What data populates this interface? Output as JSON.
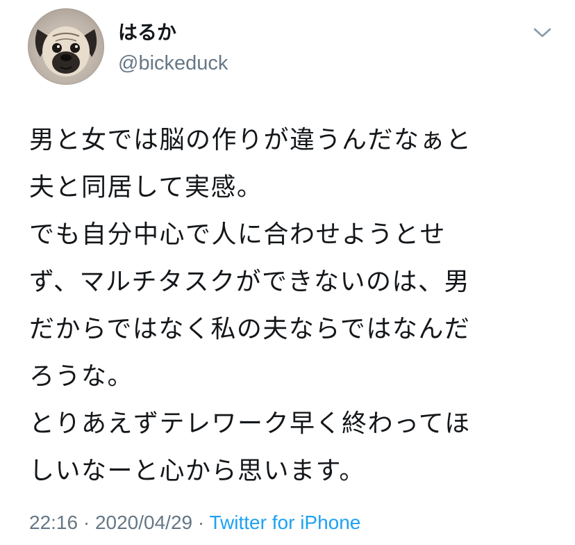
{
  "user": {
    "display_name": "はるか",
    "handle": "@bickeduck",
    "avatar_icon": "pug-avatar-icon"
  },
  "menu": {
    "icon": "chevron-down-icon"
  },
  "tweet": {
    "lines": [
      "男と女では脳の作りが違うんだなぁと",
      "夫と同居して実感。",
      "でも自分中心で人に合わせようとせ",
      "ず、マルチタスクができないのは、男",
      "だからではなく私の夫ならではなんだ",
      "ろうな。",
      "とりあえずテレワーク早く終わってほ",
      "しいなーと心から思います。"
    ]
  },
  "meta": {
    "time": "22:16",
    "separator_1": " · ",
    "date": "2020/04/29",
    "separator_2": " · ",
    "source": "Twitter for iPhone"
  },
  "colors": {
    "text": "#14171a",
    "secondary": "#657786",
    "link": "#1da1f2"
  }
}
